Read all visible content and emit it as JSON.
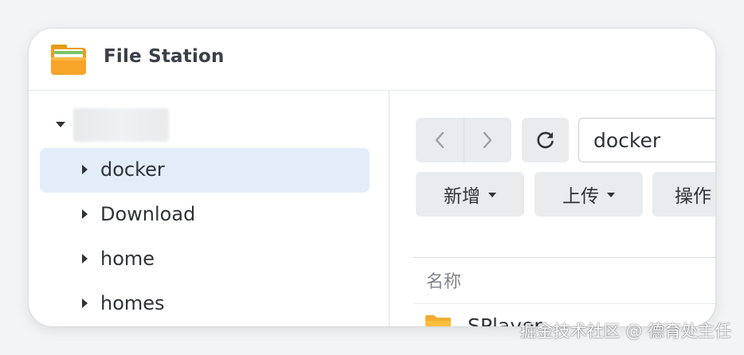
{
  "app": {
    "title": "File Station",
    "icon": "folder-app-icon"
  },
  "sidebar": {
    "root_expanded": true,
    "items": [
      {
        "label": "docker",
        "selected": true
      },
      {
        "label": "Download",
        "selected": false
      },
      {
        "label": "home",
        "selected": false
      },
      {
        "label": "homes",
        "selected": false
      }
    ]
  },
  "toolbar": {
    "back_icon": "chevron-left-icon",
    "forward_icon": "chevron-right-icon",
    "refresh_icon": "refresh-icon",
    "path_value": "docker",
    "create_label": "新增",
    "upload_label": "上传",
    "action_label": "操作"
  },
  "file_list": {
    "columns": [
      "名称"
    ],
    "rows": [
      {
        "name": "SPlayer",
        "type": "folder"
      }
    ]
  },
  "watermark": "掘金技术社区 @ 德育处主任",
  "colors": {
    "selected_bg": "#e3edfa",
    "button_bg": "#e9ecef",
    "folder": "#f7b733"
  }
}
